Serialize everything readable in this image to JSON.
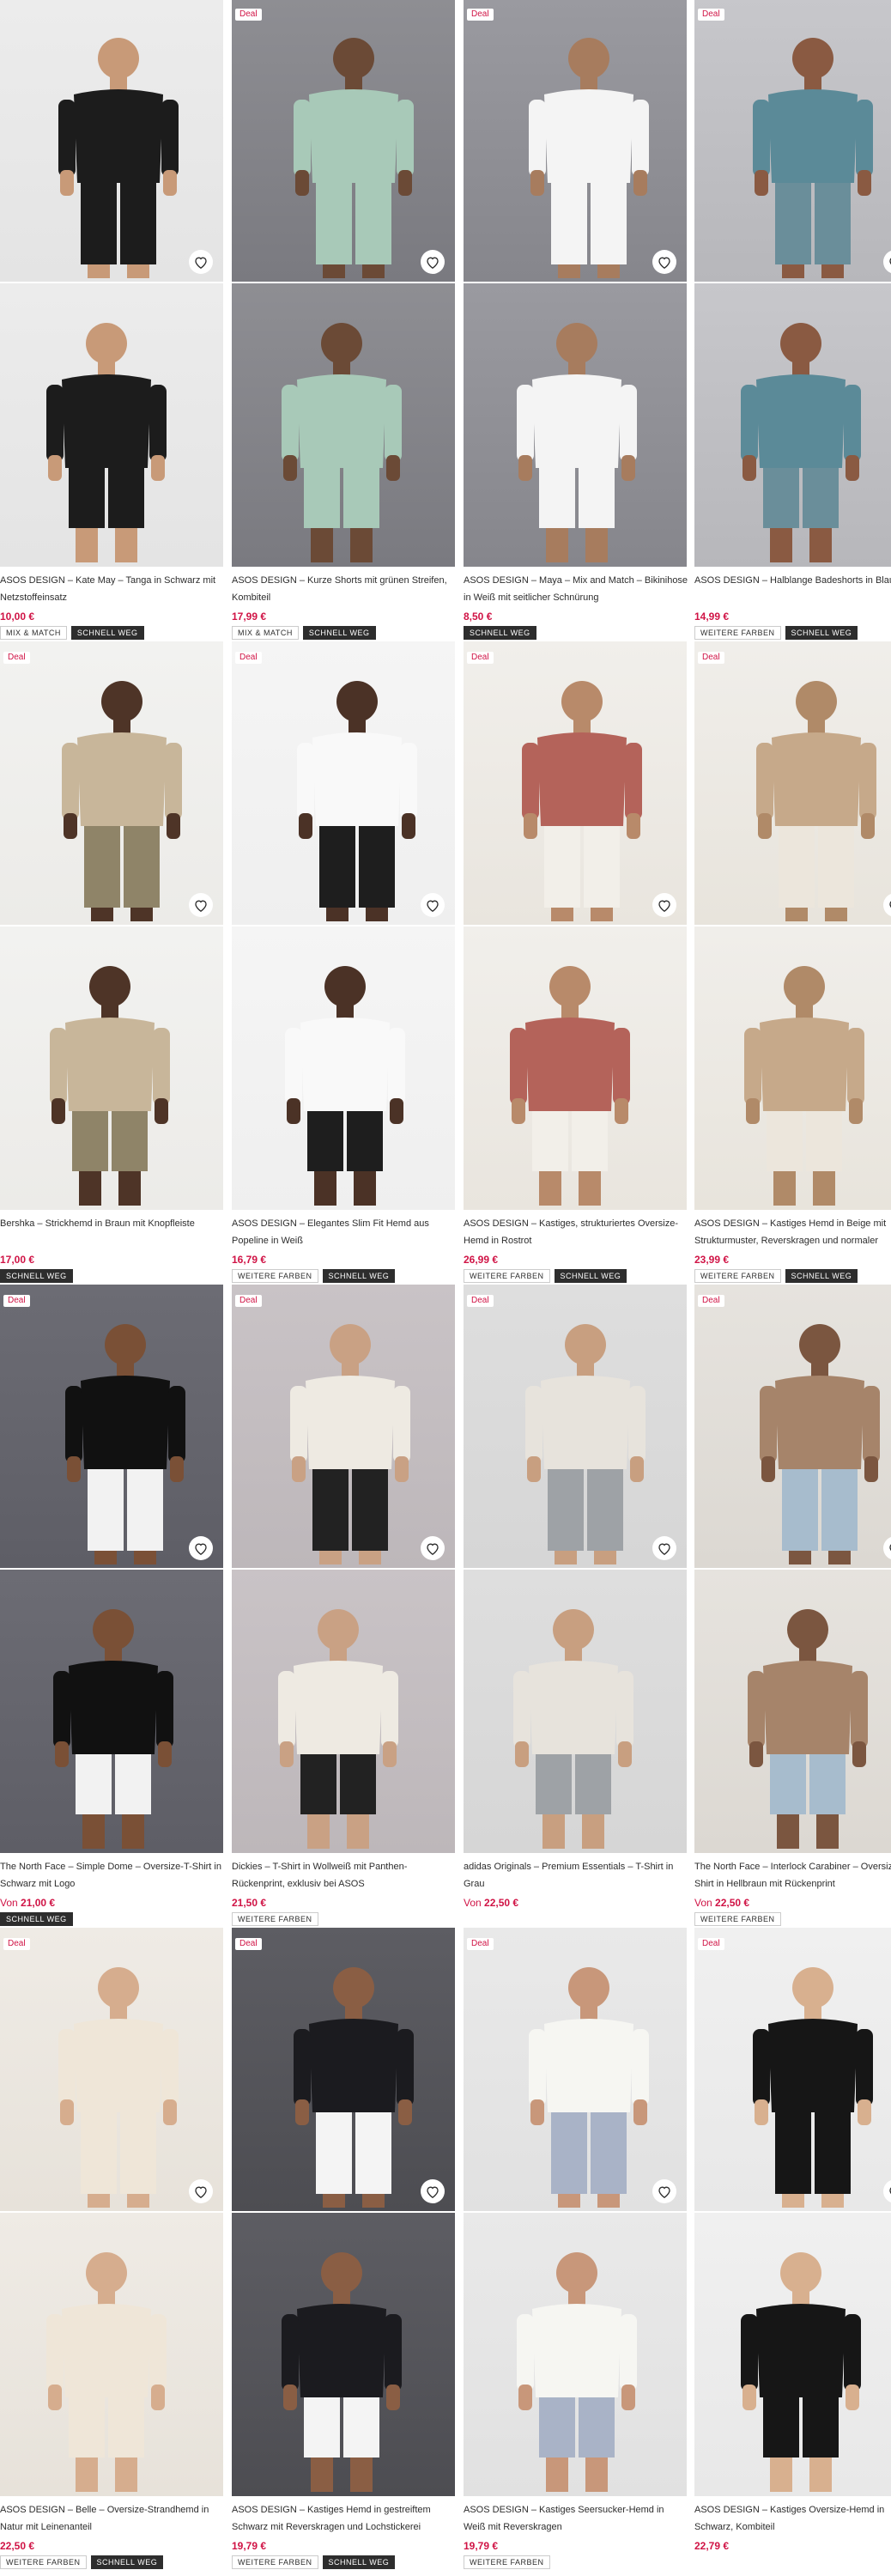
{
  "ui": {
    "deal_badge": "Deal",
    "wishlist_label": "Speichern",
    "price_from": "Von"
  },
  "colors": {
    "price": "#d01345",
    "tag_dark": "#2d2d2d"
  },
  "products": [
    {
      "title": "ASOS DESIGN – Kate May – Tanga in Schwarz mit Netzstoffeinsatz",
      "price": "10,00 €",
      "tags": [
        "MIX & MATCH",
        "SCHNELL WEG"
      ],
      "deal": false
    },
    {
      "title": "ASOS DESIGN – Kurze Shorts mit grünen Streifen, Kombiteil",
      "price": "17,99 €",
      "tags": [
        "MIX & MATCH",
        "SCHNELL WEG"
      ],
      "deal": true
    },
    {
      "title": "ASOS DESIGN – Maya – Mix and Match – Bikinihose in Weiß mit seitlicher Schnürung",
      "price": "8,50 €",
      "tags": [
        "SCHNELL WEG"
      ],
      "deal": true
    },
    {
      "title": "ASOS DESIGN – Halblange Badeshorts in Blau",
      "price": "14,99 €",
      "tags": [
        "WEITERE FARBEN",
        "SCHNELL WEG"
      ],
      "deal": true
    },
    {
      "title": "Bershka – Strickhemd in Braun mit Knopfleiste",
      "price": "17,00 €",
      "tags": [
        "SCHNELL WEG"
      ],
      "deal": true
    },
    {
      "title": "ASOS DESIGN – Elegantes Slim Fit Hemd aus Popeline in Weiß",
      "price": "16,79 €",
      "tags": [
        "WEITERE FARBEN",
        "SCHNELL WEG"
      ],
      "deal": true
    },
    {
      "title": "ASOS DESIGN – Kastiges, strukturiertes Oversize-Hemd in Rostrot",
      "price": "26,99 €",
      "tags": [
        "WEITERE FARBEN",
        "SCHNELL WEG"
      ],
      "deal": true
    },
    {
      "title": "ASOS DESIGN – Kastiges Hemd in Beige mit Strukturmuster, Reverskragen und normaler Passform",
      "price": "23,99 €",
      "tags": [
        "WEITERE FARBEN",
        "SCHNELL WEG"
      ],
      "deal": true
    },
    {
      "title": "The North Face – Simple Dome – Oversize-T-Shirt in Schwarz mit Logo",
      "price": "21,00 €",
      "from": true,
      "tags": [
        "SCHNELL WEG"
      ],
      "deal": true
    },
    {
      "title": "Dickies – T-Shirt in Wollweiß mit Panthen-Rückenprint, exklusiv bei ASOS",
      "price": "21,50 €",
      "tags": [
        "WEITERE FARBEN"
      ],
      "deal": true
    },
    {
      "title": "adidas Originals – Premium Essentials – T-Shirt in Grau",
      "price": "22,50 €",
      "from": true,
      "tags": [],
      "deal": true
    },
    {
      "title": "The North Face – Interlock Carabiner – Oversize-T-Shirt in Hellbraun mit Rückenprint",
      "price": "22,50 €",
      "from": true,
      "tags": [
        "WEITERE FARBEN"
      ],
      "deal": true
    },
    {
      "title": "ASOS DESIGN – Belle – Oversize-Strandhemd in Natur mit Leinenanteil",
      "price": "22,50 €",
      "tags": [
        "WEITERE FARBEN",
        "SCHNELL WEG"
      ],
      "deal": true
    },
    {
      "title": "ASOS DESIGN – Kastiges Hemd in gestreiftem Schwarz mit Reverskragen und Lochstickerei",
      "price": "19,79 €",
      "tags": [
        "WEITERE FARBEN",
        "SCHNELL WEG"
      ],
      "deal": true
    },
    {
      "title": "ASOS DESIGN – Kastiges Seersucker-Hemd in Weiß mit Reverskragen",
      "price": "19,79 €",
      "tags": [
        "WEITERE FARBEN"
      ],
      "deal": true
    },
    {
      "title": "ASOS DESIGN – Kastiges Oversize-Hemd in Schwarz, Kombiteil",
      "price": "22,79 €",
      "tags": [],
      "deal": true
    }
  ]
}
